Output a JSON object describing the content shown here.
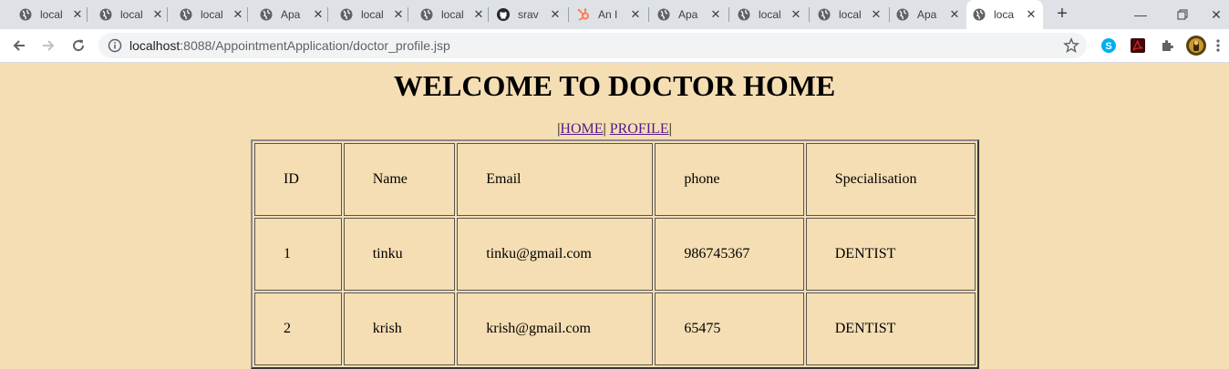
{
  "browser": {
    "tabs": [
      {
        "title": "local",
        "icon": "globe-icon"
      },
      {
        "title": "local",
        "icon": "globe-icon"
      },
      {
        "title": "local",
        "icon": "globe-icon"
      },
      {
        "title": "Apa",
        "icon": "globe-icon"
      },
      {
        "title": "local",
        "icon": "globe-icon"
      },
      {
        "title": "local",
        "icon": "globe-icon"
      },
      {
        "title": "srav",
        "icon": "github-icon"
      },
      {
        "title": "An I",
        "icon": "hubspot-icon"
      },
      {
        "title": "Apa",
        "icon": "globe-icon"
      },
      {
        "title": "local",
        "icon": "globe-icon"
      },
      {
        "title": "local",
        "icon": "globe-icon"
      },
      {
        "title": "Apa",
        "icon": "globe-icon"
      },
      {
        "title": "loca",
        "icon": "globe-icon",
        "active": true
      }
    ],
    "url_host": "localhost",
    "url_rest": ":8088/AppointmentApplication/doctor_profile.jsp",
    "colors": {
      "tabstrip": "#dee1e6",
      "page_bg": "#f5deb3",
      "link": "#551a8b"
    }
  },
  "page": {
    "heading": "WELCOME TO DOCTOR HOME",
    "nav": {
      "sep_left": "|",
      "home": "HOME",
      "sep_mid": "|",
      "profile": "PROFILE",
      "sep_right": "|"
    },
    "table": {
      "headers": [
        "ID",
        "Name",
        "Email",
        "phone",
        "Specialisation"
      ],
      "rows": [
        [
          "1",
          "tinku",
          "tinku@gmail.com",
          "986745367",
          "DENTIST"
        ],
        [
          "2",
          "krish",
          "krish@gmail.com",
          "65475",
          "DENTIST"
        ]
      ]
    }
  }
}
